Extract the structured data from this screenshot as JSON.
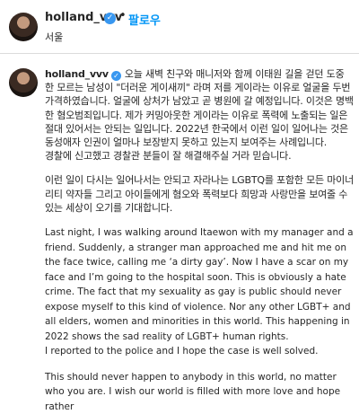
{
  "header": {
    "username": "holland_vvv",
    "verified_icon": "verified-badge-icon",
    "separator": "•",
    "follow_label": "팔로우",
    "location": "서울"
  },
  "comment": {
    "username": "holland_vvv",
    "paragraphs": [
      "오늘 새벽 친구와 매니저와 함께 이태원 길을 걷던 도중 한 모르는 남성이 \"더러운 게이새끼\" 라며 저를 게이라는 이유로 얼굴을 두번 가격하였습니다. 얼굴에 상처가 남았고 곧 병원에 갈 예정입니다. 이것은 명백한 혐오범죄입니다. 제가 커밍아웃한 게이라는 이유로 폭력에 노출되는 일은 절대 있어서는 안되는 일입니다. 2022년 한국에서 이런 일이 일어나는 것은 동성애자 인권이 얼마나 보장받지 못하고 있는지 보여주는 사례입니다.",
      "경찰에 신고했고 경찰관 분들이 잘 해결해주실 거라 믿습니다.",
      "이런 일이 다시는 일어나서는 안되고 자라나는 LGBTQ를 포함한 모든 마이너리티 약자들 그리고 아이들에게 혐오와 폭력보다 희망과 사랑만을 보여줄 수 있는 세상이 오기를 기대합니다.",
      "Last night, I was walking around Itaewon with my manager and a friend. Suddenly, a stranger man approached me and hit me on the face twice, calling me ‘a dirty gay’. Now I have a scar on my face and I’m going to the hospital soon. This is obviously a hate crime. The fact that my sexuality as gay is public should never expose myself to this kind of violence. Nor any other LGBT+ and all elders, women and minorities in this world. This happening in 2022 shows the sad reality of LGBT+ human rights.",
      "I reported to the police and I hope the case is well solved.",
      "This should never happen to anybody in this world, no matter who you are. I wish our world is filled with more love and hope rather"
    ]
  },
  "colors": {
    "follow_blue": "#0095f6",
    "verified_blue": "#3897f0",
    "text": "#262626",
    "divider": "#dbdbdb"
  }
}
